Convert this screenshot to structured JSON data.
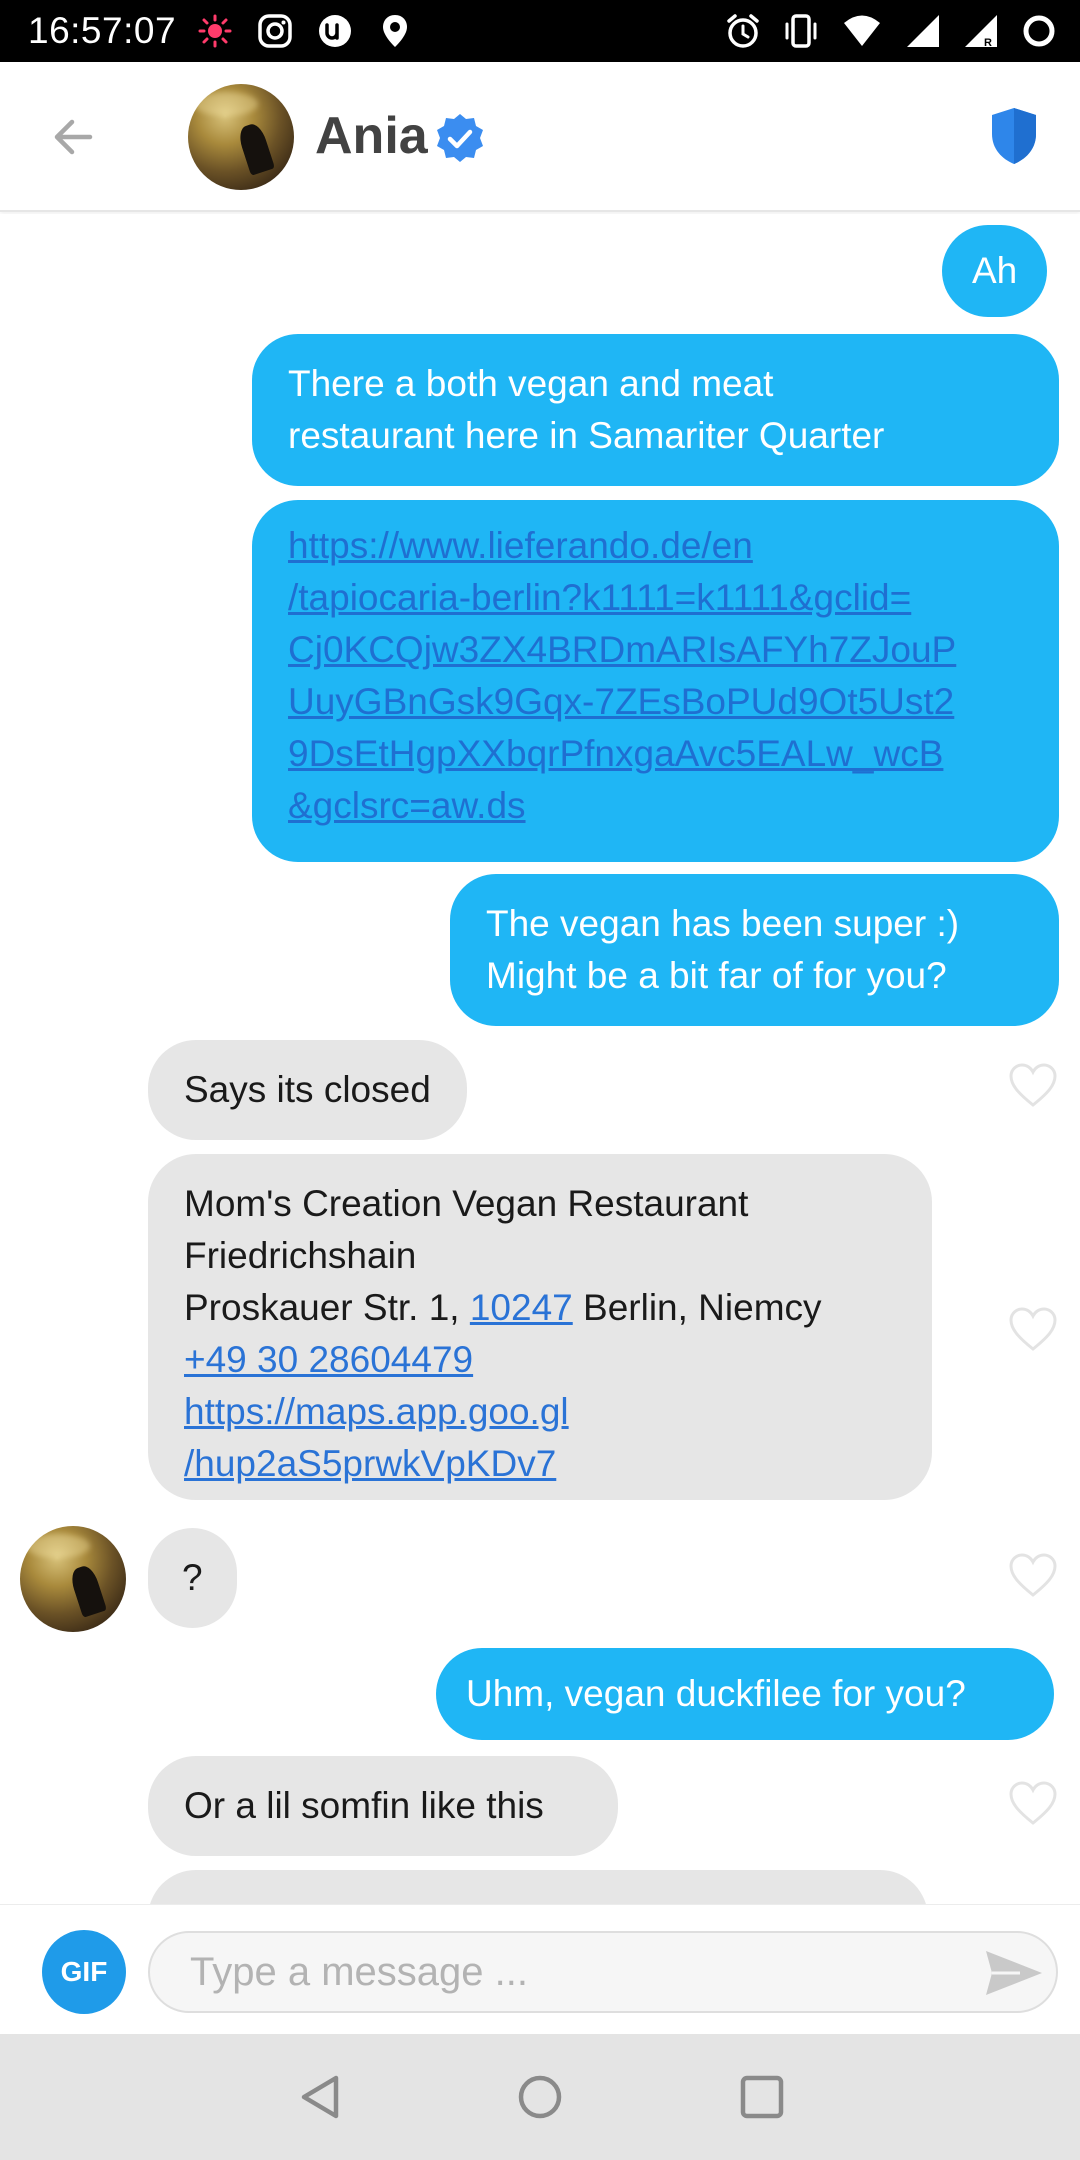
{
  "status_bar": {
    "time": "16:57:07",
    "left_icons": [
      "notification-dot-icon",
      "instagram-icon",
      "app-u-icon",
      "location-pin-icon"
    ],
    "right_icons": [
      "alarm-icon",
      "vibrate-icon",
      "wifi-icon",
      "signal-icon",
      "signal-roaming-icon",
      "battery-ring-icon"
    ]
  },
  "header": {
    "back_icon": "arrow-left-icon",
    "contact_name": "Ania",
    "verified_icon": "verified-badge-icon",
    "safety_icon": "shield-icon",
    "accent": "#3b8df0"
  },
  "messages": [
    {
      "side": "sent",
      "text": "Ah"
    },
    {
      "side": "sent",
      "lines": [
        "There a both vegan and meat",
        "restaurant here in Samariter Quarter"
      ]
    },
    {
      "side": "sent",
      "link_lines": [
        "https://www.lieferando.de/en",
        "/tapiocaria-berlin?k1111=k1111&gclid=",
        "Cj0KCQjw3ZX4BRDmARIsAFYh7ZJouP",
        "UuyGBnGsk9Gqx-7ZEsBoPUd9Ot5Ust2",
        "9DsEtHgpXXbqrPfnxgaAvc5EALw_wcB",
        "&gclsrc=aw.ds"
      ]
    },
    {
      "side": "sent",
      "lines": [
        "The vegan has been super :)",
        "Might be a bit far of for you?"
      ]
    },
    {
      "side": "recv",
      "text": "Says its closed"
    },
    {
      "side": "recv",
      "line1": "Mom's Creation Vegan Restaurant",
      "line2": "Friedrichshain",
      "line3_pre": "Proskauer Str. 1, ",
      "line3_link": "10247",
      "line3_post": " Berlin, Niemcy",
      "phone": "+49 30 28604479",
      "map_link_1": "https://maps.app.goo.gl",
      "map_link_2": "/hup2aS5prwkVpKDv7"
    },
    {
      "side": "recv",
      "text": "?"
    },
    {
      "side": "sent",
      "text": "Uhm, vegan duckfilee for you?"
    },
    {
      "side": "recv",
      "text": "Or a lil somfin like this"
    }
  ],
  "composer": {
    "gif_label": "GIF",
    "placeholder": "Type a message ...",
    "send_icon": "send-arrow-icon"
  },
  "nav_bar": {
    "icons": [
      "nav-back-icon",
      "nav-home-icon",
      "nav-recents-icon"
    ]
  },
  "colors": {
    "sent_bubble": "#1fb6f5",
    "received_bubble": "#e6e6e6",
    "gif_button": "#1f9be9"
  }
}
